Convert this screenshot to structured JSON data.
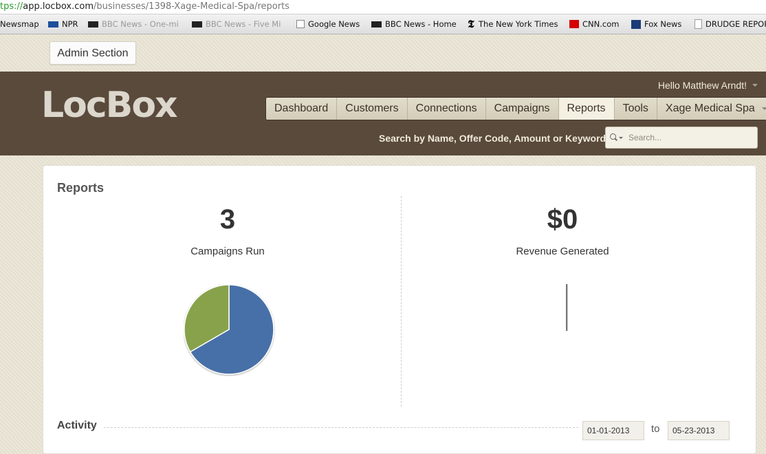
{
  "browser": {
    "url_scheme": "tps://",
    "url_host": "app.locbox.com",
    "url_path": "/businesses/1398-Xage-Medical-Spa/reports"
  },
  "bookmarks": [
    {
      "label": "Newsmap",
      "icon": "none"
    },
    {
      "label": "NPR",
      "icon": "npr-icon"
    },
    {
      "label": "BBC News - One-mi",
      "icon": "bbc-icon"
    },
    {
      "label": "BBC News - Five Mi",
      "icon": "bbc-icon"
    },
    {
      "label": "Google News",
      "icon": "google-news-icon"
    },
    {
      "label": "BBC News - Home",
      "icon": "bbc-icon"
    },
    {
      "label": "The New York Times",
      "icon": "nyt-icon"
    },
    {
      "label": "CNN.com",
      "icon": "cnn-icon"
    },
    {
      "label": "Fox News",
      "icon": "fox-icon"
    },
    {
      "label": "DRUDGE REPORT",
      "icon": "page-icon"
    }
  ],
  "admin": {
    "label": "Admin Section"
  },
  "header": {
    "logo": "LocBox",
    "greeting": "Hello Matthew Arndt!",
    "nav": [
      {
        "label": "Dashboard",
        "active": false
      },
      {
        "label": "Customers",
        "active": false
      },
      {
        "label": "Connections",
        "active": false
      },
      {
        "label": "Campaigns",
        "active": false
      },
      {
        "label": "Reports",
        "active": true
      },
      {
        "label": "Tools",
        "active": false
      },
      {
        "label": "Xage Medical Spa",
        "active": false
      }
    ],
    "search_label": "Search by Name, Offer Code, Amount or Keyword",
    "search_placeholder": "Search..."
  },
  "reports": {
    "title": "Reports",
    "campaigns_value": "3",
    "campaigns_label": "Campaigns Run",
    "revenue_value": "$0",
    "revenue_label": "Revenue Generated",
    "pie_colors": {
      "blue": "#4670a8",
      "green": "#88a24c"
    },
    "activity_label": "Activity",
    "date_from": "01-01-2013",
    "date_to_label": "to",
    "date_to": "05-23-2013"
  }
}
